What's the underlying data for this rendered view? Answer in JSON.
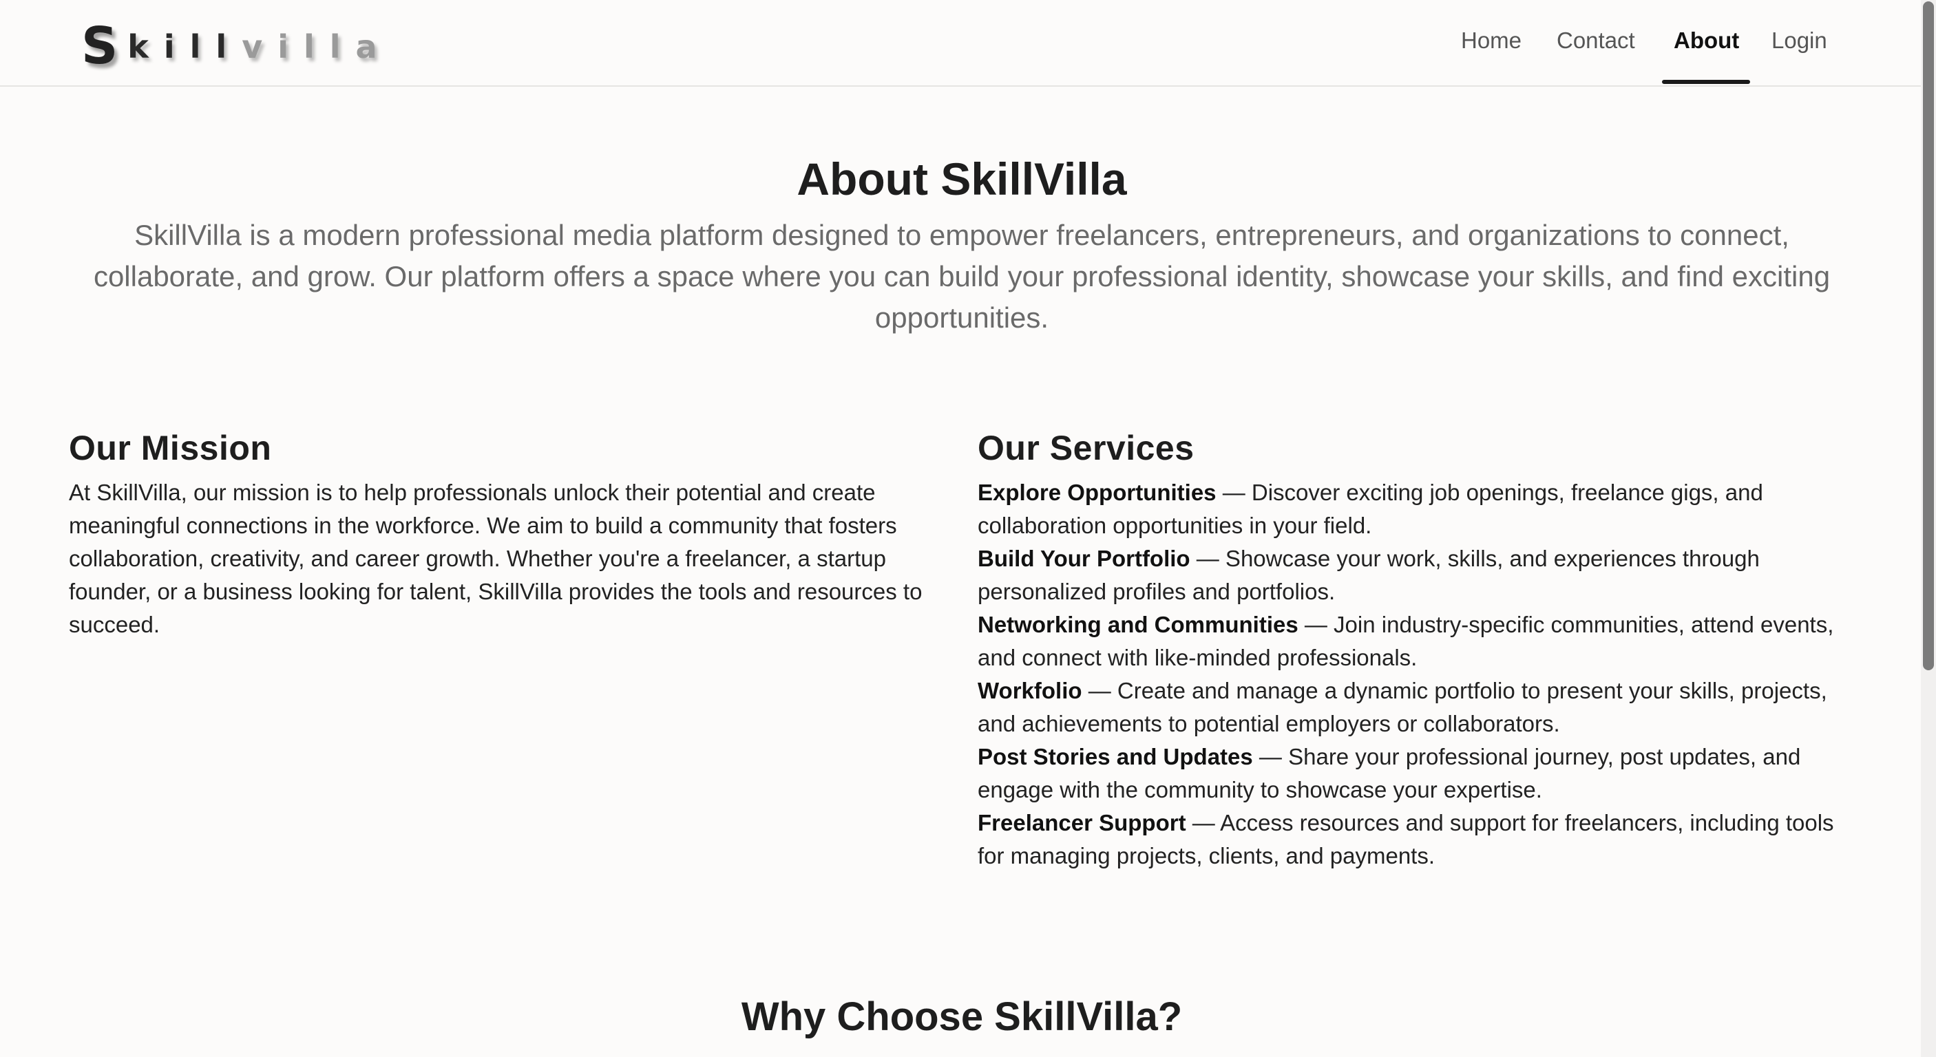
{
  "brand": {
    "first_letter": "S",
    "dark_part": "kill",
    "light_part": "villa"
  },
  "nav": {
    "items": [
      {
        "label": "Home",
        "active": false
      },
      {
        "label": "Contact",
        "active": false
      },
      {
        "label": "About",
        "active": true
      },
      {
        "label": "Login",
        "active": false
      }
    ]
  },
  "hero": {
    "title": "About SkillVilla",
    "text": "SkillVilla is a modern professional media platform designed to empower freelancers, entrepreneurs, and organizations to connect, collaborate, and grow. Our platform offers a space where you can build your professional identity, showcase your skills, and find exciting opportunities."
  },
  "mission": {
    "title": "Our Mission",
    "text": "At SkillVilla, our mission is to help professionals unlock their potential and create meaningful connections in the workforce. We aim to build a community that fosters collaboration, creativity, and career growth. Whether you're a freelancer, a startup founder, or a business looking for talent, SkillVilla provides the tools and resources to succeed."
  },
  "services": {
    "title": "Our Services",
    "items": [
      {
        "name": "Explore Opportunities",
        "desc": " — Discover exciting job openings, freelance gigs, and collaboration opportunities in your field."
      },
      {
        "name": "Build Your Portfolio",
        "desc": " — Showcase your work, skills, and experiences through personalized profiles and portfolios."
      },
      {
        "name": "Networking and Communities",
        "desc": " — Join industry-specific communities, attend events, and connect with like-minded professionals."
      },
      {
        "name": "Workfolio",
        "desc": " — Create and manage a dynamic portfolio to present your skills, projects, and achievements to potential employers or collaborators."
      },
      {
        "name": "Post Stories and Updates",
        "desc": " — Share your professional journey, post updates, and engage with the community to showcase your expertise."
      },
      {
        "name": "Freelancer Support",
        "desc": " — Access resources and support for freelancers, including tools for managing projects, clients, and payments."
      }
    ]
  },
  "why": {
    "title": "Why Choose SkillVilla?"
  }
}
